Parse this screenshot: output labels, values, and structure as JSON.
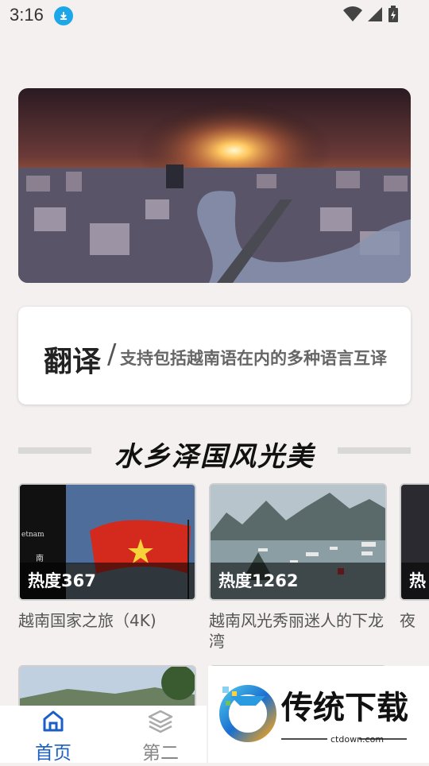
{
  "status": {
    "time": "3:16"
  },
  "card": {
    "title": "翻译",
    "slash": "/",
    "desc": "支持包括越南语在内的多种语言互译"
  },
  "section": {
    "title": "水乡泽国风光美"
  },
  "videos": [
    {
      "hot": "热度367",
      "title": "越南国家之旅（4K)",
      "overlay_text": "etnam",
      "overlay_sub": "南"
    },
    {
      "hot": "热度1262",
      "title": "越南风光秀丽迷人的下龙湾"
    },
    {
      "hot": "热",
      "title": "夜"
    }
  ],
  "tabs": [
    {
      "label": "首页",
      "icon": "home-icon",
      "active": true
    },
    {
      "label": "第二",
      "icon": "layers-icon",
      "active": false
    }
  ],
  "watermark": {
    "brand": "传统下载",
    "url": "ctdown.com"
  },
  "colors": {
    "accent": "#1a5fc4",
    "inactive": "#999999",
    "status_badge": "#1ea7e8"
  }
}
